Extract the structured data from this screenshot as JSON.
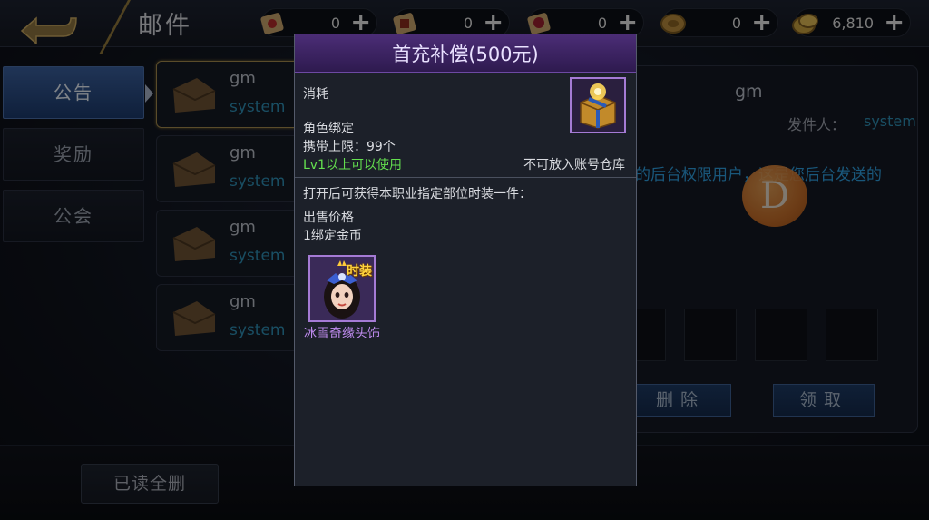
{
  "header": {
    "title": "邮件",
    "resources": [
      {
        "icon": "scroll-red-icon",
        "value": "0"
      },
      {
        "icon": "scroll-map-icon",
        "value": "0"
      },
      {
        "icon": "scroll-seal-icon",
        "value": "0"
      },
      {
        "icon": "coin-bronze-icon",
        "value": "0"
      },
      {
        "icon": "coin-gold-icon",
        "value": "6,810"
      }
    ],
    "plus": "+"
  },
  "tabs": [
    {
      "label": "公告",
      "active": true
    },
    {
      "label": "奖励",
      "active": false
    },
    {
      "label": "公会",
      "active": false
    }
  ],
  "mails": [
    {
      "sender": "gm",
      "system": "system"
    },
    {
      "sender": "gm",
      "system": "system"
    },
    {
      "sender": "gm",
      "system": "system"
    },
    {
      "sender": "gm",
      "system": "system"
    }
  ],
  "detail": {
    "sender_name": "gm",
    "from_label": "发件人：",
    "from_value": "system",
    "body": "的后台权限用户，这是您后台发送的",
    "coin_letter": "D",
    "delete_label": "删除",
    "claim_label": "领取"
  },
  "bottom": {
    "delete_read_label": "已读全删"
  },
  "popup": {
    "title": "首充补偿(500元)",
    "category": "消耗",
    "bind": "角色绑定",
    "carry_limit": "携带上限：99个",
    "level_req": "Lv1以上可以使用",
    "storage_note": "不可放入账号仓库",
    "description": "打开后可获得本职业指定部位时装一件：",
    "price_label": "出售价格",
    "price_value": "1绑定金币",
    "reward_badge": "时装",
    "reward_name": "冰雪奇缘头饰"
  },
  "colors": {
    "accent_blue": "#2f8fb5",
    "popup_purple": "#4b2d76",
    "green": "#64e04f",
    "reward_name": "#c08cf0",
    "gold_trim": "#a48b4d"
  }
}
